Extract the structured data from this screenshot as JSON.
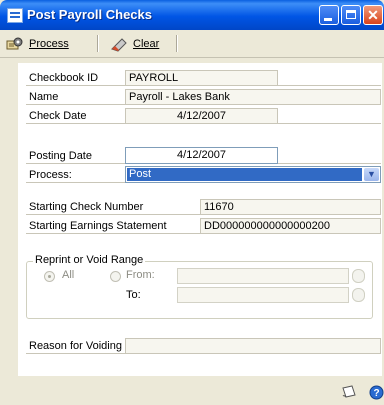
{
  "window": {
    "title": "Post Payroll Checks"
  },
  "toolbar": {
    "process_label": "Process",
    "clear_label": "Clear"
  },
  "fields": {
    "checkbook_id_label": "Checkbook ID",
    "checkbook_id_value": "PAYROLL",
    "name_label": "Name",
    "name_value": "Payroll - Lakes Bank",
    "check_date_label": "Check Date",
    "check_date_value": "4/12/2007",
    "posting_date_label": "Posting Date",
    "posting_date_value": "4/12/2007",
    "process_label": "Process:",
    "process_value": "Post",
    "starting_check_number_label": "Starting Check Number",
    "starting_check_number_value": "11670",
    "starting_earnings_label": "Starting Earnings Statement",
    "starting_earnings_value": "DD000000000000000200"
  },
  "range": {
    "title": "Reprint or Void Range",
    "all_label": "All",
    "from_label": "From:",
    "to_label": "To:"
  },
  "reason": {
    "label": "Reason for Voiding"
  },
  "icons": {
    "process": "pay-checks-icon",
    "clear": "eraser-icon",
    "note": "note-icon",
    "help": "help-icon"
  }
}
